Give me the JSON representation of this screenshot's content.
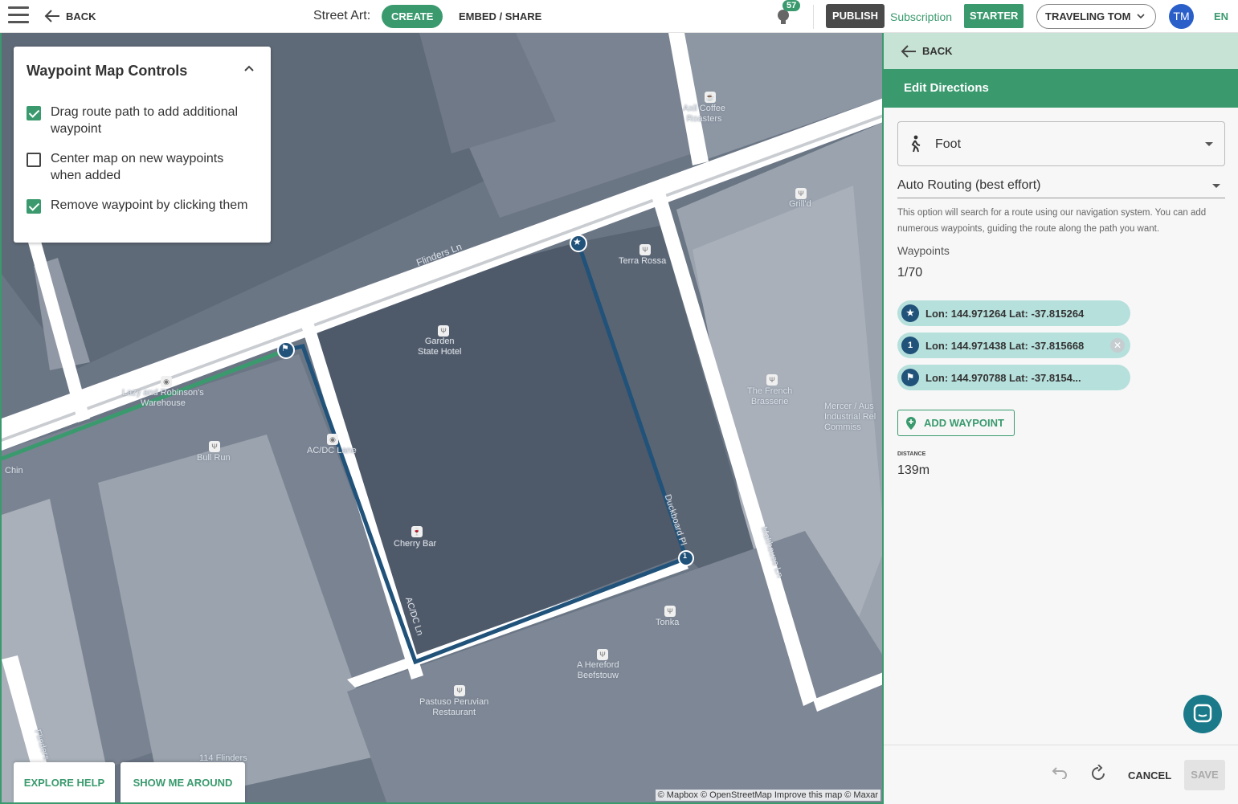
{
  "topbar": {
    "back_label": "BACK",
    "app_label": "Street Art:",
    "create_label": "CREATE",
    "embed_label": "EMBED / SHARE",
    "notification_count": "57",
    "publish_label": "PUBLISH",
    "subscription_label": "Subscription",
    "plan_label": "STARTER",
    "user_name": "TRAVELING TOM",
    "avatar_initials": "TM",
    "language": "EN"
  },
  "map_controls": {
    "title": "Waypoint Map Controls",
    "options": [
      {
        "label": "Drag route path to add additional waypoint",
        "checked": true
      },
      {
        "label": "Center map on new waypoints when added",
        "checked": false
      },
      {
        "label": "Remove waypoint by clicking them",
        "checked": true
      }
    ]
  },
  "map": {
    "labels": {
      "flinders_ln": "Flinders Ln",
      "duckboard": "Duckboard Pl",
      "acdc_ln": "AC/DC Ln",
      "malthouse": "Malthouse Ln",
      "flinders_bottom": "Flinders",
      "axil": "Axil Coffee\nRoasters",
      "grill": "Grill'd",
      "terra": "Terra Rossa",
      "garden": "Garden\nState Hotel",
      "lazy": "Lazy and Robinson's\nWarehouse",
      "bull": "Bull Run",
      "acdc_lane": "AC/DC Lane",
      "french": "The French\nBrasserie",
      "mercer": "Mercer / Aus\nIndustrial Rel\nCommiss",
      "cherry": "Cherry Bar",
      "tonka": "Tonka",
      "hereford": "A Hereford\nBeefstouw",
      "pastuso": "Pastuso Peruvian\nRestaurant",
      "chin": "Chin",
      "flinders_park": "114 Flinders\nark"
    },
    "explore_help": "EXPLORE HELP",
    "show_me_around": "SHOW ME AROUND",
    "attribution": "© Mapbox © OpenStreetMap Improve this map © Maxar"
  },
  "panel": {
    "back_label": "BACK",
    "heading": "Edit Directions",
    "mode": "Foot",
    "routing": "Auto Routing (best effort)",
    "hint": "This option will search for a route using our navigation system. You can add numerous waypoints, guiding the route along the path you want.",
    "waypoints_label": "Waypoints",
    "waypoints_count": "1/70",
    "waypoints": [
      {
        "marker": "★",
        "text": "Lon: 144.971264 Lat: -37.815264"
      },
      {
        "marker": "1",
        "text": "Lon: 144.971438 Lat: -37.815668"
      },
      {
        "marker": "⚑",
        "text": "Lon: 144.970788 Lat: -37.8154..."
      }
    ],
    "add_waypoint": "ADD WAYPOINT",
    "distance_label": "DISTANCE",
    "distance_value": "139m",
    "cancel": "CANCEL",
    "save": "SAVE"
  },
  "colors": {
    "accent": "#3a9a6e",
    "route": "#20527a",
    "chip": "#b6e0dc"
  }
}
